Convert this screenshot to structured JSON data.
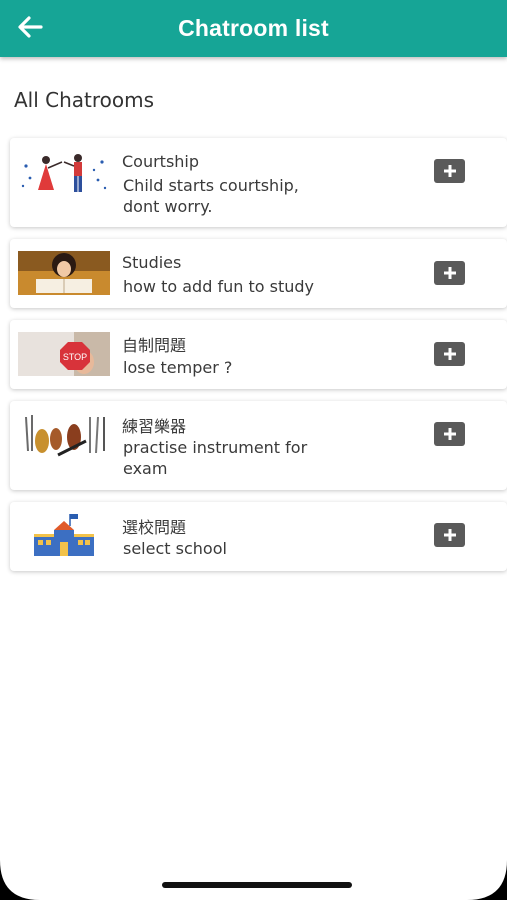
{
  "header": {
    "title": "Chatroom list",
    "back_icon": "arrow-left-icon",
    "color": "#16a596"
  },
  "section": {
    "title": "All Chatrooms"
  },
  "chatrooms": [
    {
      "title": "Courtship",
      "subtitle": "Child starts courtship,\ndont worry.",
      "thumbnail": "dancing-couple-image",
      "action_icon": "plus-square-icon"
    },
    {
      "title": "Studies",
      "subtitle": "how to add fun to study",
      "thumbnail": "studying-child-image",
      "action_icon": "plus-square-icon"
    },
    {
      "title": "自制問題",
      "subtitle": "lose temper ?",
      "thumbnail": "stop-sign-image",
      "thumb_text": "STOP",
      "action_icon": "plus-square-icon"
    },
    {
      "title": "練習樂器",
      "subtitle": "practise instrument for\nexam",
      "thumbnail": "instruments-image",
      "action_icon": "plus-square-icon"
    },
    {
      "title": "選校問題",
      "subtitle": "select school",
      "thumbnail": "school-building-image",
      "action_icon": "plus-square-icon"
    }
  ]
}
